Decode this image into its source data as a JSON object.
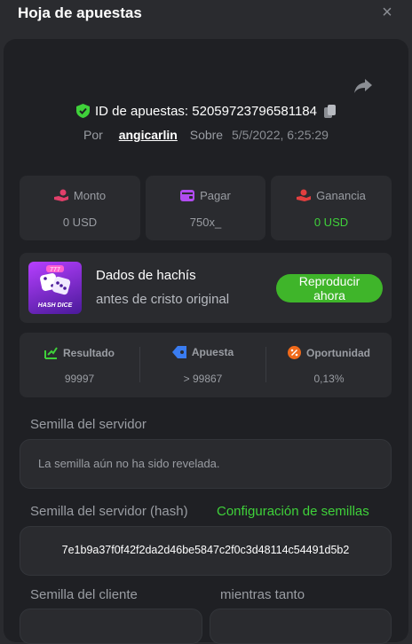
{
  "header": {
    "title": "Hoja de apuestas",
    "close_label": "×"
  },
  "bet": {
    "id_label": "ID de apuestas:",
    "id_value": "52059723796581184",
    "by_label": "Por",
    "username": "angicarlin",
    "on_label": "Sobre",
    "date": "5/5/2022, 6:25:29"
  },
  "stats": [
    {
      "label": "Monto",
      "value": "0 USD",
      "icon": "money-hand-icon",
      "value_color": "#9a9da3"
    },
    {
      "label": "Pagar",
      "value": "750x_",
      "icon": "wallet-icon",
      "value_color": "#9a9da3"
    },
    {
      "label": "Ganancia",
      "value": "0 USD",
      "icon": "profit-hand-icon",
      "value_color": "#3fd13a"
    }
  ],
  "game": {
    "name": "Dados de hachís",
    "subtitle": "antes de cristo original",
    "thumb_text": "HASH DICE",
    "play_label_1": "Reproducir",
    "play_label_2": "ahora"
  },
  "results": [
    {
      "label": "Resultado",
      "value": "99997",
      "icon": "result-icon"
    },
    {
      "label": "Apuesta",
      "value": "> 99867",
      "icon": "bet-tag-icon"
    },
    {
      "label": "Oportunidad",
      "value": "0,13%",
      "icon": "percent-icon"
    }
  ],
  "seeds": {
    "server_label": "Semilla del servidor",
    "server_value": "La semilla aún no ha sido revelada.",
    "server_hash_label": "Semilla del servidor (hash)",
    "config_link": "Configuración de semillas",
    "server_hash_value": "7e1b9a37f0f42f2da2d46be5847c2f0c3d48114c54491d5b2",
    "client_label": "Semilla del cliente",
    "nonce_label": "mientras tanto"
  },
  "colors": {
    "accent_green": "#3fd13a",
    "button_green": "#3fb52a",
    "panel_bg": "#1f2024"
  }
}
